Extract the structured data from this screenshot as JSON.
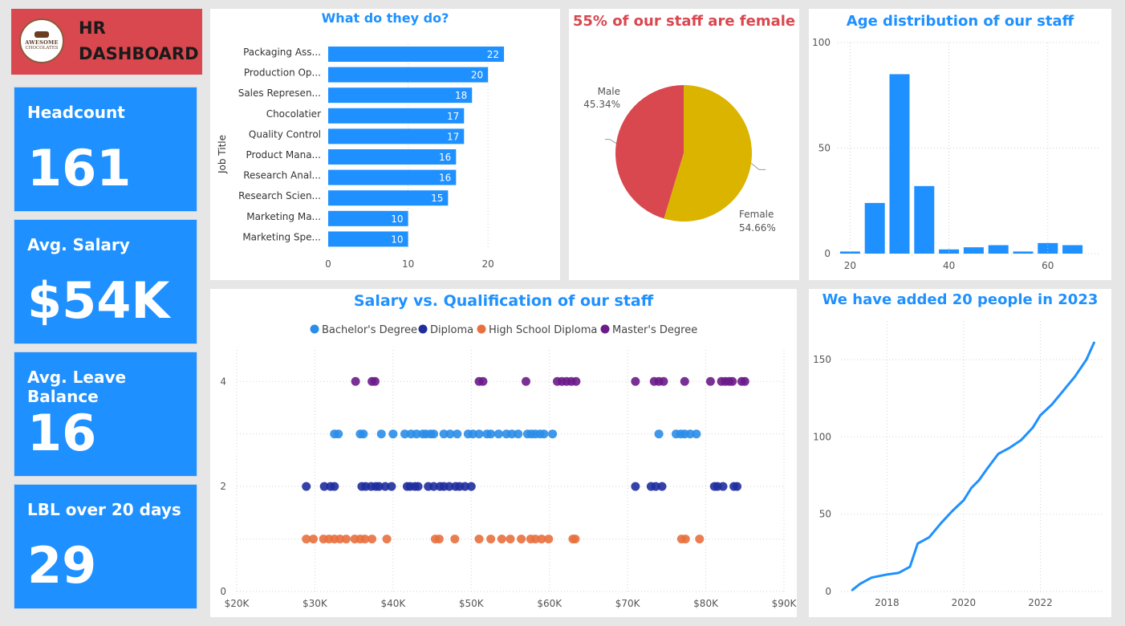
{
  "header": {
    "logo_line1": "AWESOME",
    "logo_line2": "CHOCOLATES",
    "title": "HR DASHBOARD"
  },
  "kpis": [
    {
      "label": "Headcount",
      "value": "161"
    },
    {
      "label": "Avg. Salary",
      "value": "$54K"
    },
    {
      "label": "Avg. Leave Balance",
      "value": "16"
    },
    {
      "label": "LBL over 20 days",
      "value": "29"
    }
  ],
  "colors": {
    "accent": "#1e90ff",
    "header": "#d9474f",
    "female": "#dbb400",
    "male": "#d9474f",
    "bachelor": "#2a8de8",
    "diploma": "#1f2d9e",
    "highschool": "#e8703e",
    "master": "#6b1b8a"
  },
  "jobs_chart": {
    "title": "What do they do?",
    "ylabel": "Job Title",
    "chart_data": {
      "type": "bar",
      "orientation": "horizontal",
      "categories": [
        "Packaging Ass...",
        "Production Op...",
        "Sales Represen...",
        "Chocolatier",
        "Quality Control",
        "Product Mana...",
        "Research Anal...",
        "Research Scien...",
        "Marketing Ma...",
        "Marketing Spe..."
      ],
      "values": [
        22,
        20,
        18,
        17,
        17,
        16,
        16,
        15,
        10,
        10
      ],
      "xticks": [
        "0",
        "10",
        "20"
      ],
      "xlim": [
        0,
        24
      ]
    }
  },
  "gender_chart": {
    "title": "55% of our staff are female",
    "chart_data": {
      "type": "pie",
      "labels": [
        "Male",
        "Female"
      ],
      "values": [
        45.34,
        54.66
      ],
      "pct_labels": [
        "45.34%",
        "54.66%"
      ]
    }
  },
  "age_chart": {
    "title": "Age distribution of our staff",
    "chart_data": {
      "type": "bar",
      "x": [
        20,
        25,
        30,
        35,
        40,
        45,
        50,
        55,
        60,
        65
      ],
      "values": [
        1,
        24,
        85,
        32,
        2,
        3,
        4,
        1,
        5,
        4
      ],
      "xticks": [
        "20",
        "40",
        "60"
      ],
      "yticks": [
        "0",
        "50",
        "100"
      ],
      "ylim": [
        0,
        100
      ]
    }
  },
  "scatter_chart": {
    "title": "Salary vs. Qualification of our staff",
    "legend": [
      "Bachelor's Degree",
      "Diploma",
      "High School Diploma",
      "Master's Degree"
    ],
    "chart_data": {
      "type": "scatter",
      "xticks": [
        "$20K",
        "$30K",
        "$40K",
        "$50K",
        "$60K",
        "$70K",
        "$80K",
        "$90K"
      ],
      "yticks": [
        "0",
        "2",
        "4"
      ],
      "xlim": [
        20000,
        90000
      ],
      "ylim": [
        0,
        4.6
      ],
      "series": [
        {
          "name": "Bachelor's Degree",
          "y": 3,
          "x": [
            32500,
            33000,
            35800,
            36200,
            38500,
            40000,
            41500,
            42300,
            43000,
            43800,
            44200,
            44800,
            45200,
            46500,
            47300,
            48200,
            49600,
            50200,
            51000,
            52000,
            52500,
            53500,
            54500,
            55200,
            56000,
            57200,
            57700,
            58200,
            58800,
            59300,
            60400,
            74000,
            76200,
            76800,
            77300,
            78000,
            78800
          ]
        },
        {
          "name": "Diploma",
          "y": 2,
          "x": [
            28900,
            31200,
            32000,
            32500,
            36000,
            36500,
            37200,
            37800,
            38200,
            39000,
            39800,
            41800,
            42200,
            42800,
            43200,
            44500,
            45200,
            46000,
            46500,
            47200,
            48000,
            48500,
            49200,
            50000,
            71000,
            73000,
            73600,
            74400,
            81100,
            81500,
            82200,
            83600,
            84000
          ]
        },
        {
          "name": "High School Diploma",
          "y": 1,
          "x": [
            28900,
            29800,
            31100,
            31800,
            32500,
            33200,
            34000,
            35100,
            35800,
            36400,
            37300,
            39200,
            45400,
            45900,
            47900,
            51000,
            52500,
            53900,
            55000,
            56400,
            57600,
            58200,
            59000,
            59900,
            63000,
            63300,
            76900,
            77400,
            79200
          ]
        },
        {
          "name": "Master's Degree",
          "y": 4,
          "x": [
            35200,
            37300,
            37700,
            51000,
            51500,
            57000,
            61000,
            61600,
            62200,
            62800,
            63400,
            71000,
            73400,
            74000,
            74600,
            77300,
            80600,
            82000,
            82500,
            83000,
            83400,
            84600,
            85000
          ]
        }
      ]
    }
  },
  "growth_chart": {
    "title": "We have added 20 people in 2023",
    "chart_data": {
      "type": "line",
      "x": [
        2017.1,
        2017.3,
        2017.6,
        2018.0,
        2018.3,
        2018.6,
        2018.8,
        2019.1,
        2019.4,
        2019.7,
        2020.0,
        2020.2,
        2020.4,
        2020.6,
        2020.9,
        2021.2,
        2021.5,
        2021.8,
        2022.0,
        2022.3,
        2022.6,
        2022.9,
        2023.2,
        2023.4
      ],
      "values": [
        1,
        5,
        9,
        11,
        12,
        16,
        31,
        35,
        44,
        52,
        59,
        67,
        72,
        79,
        89,
        93,
        98,
        106,
        114,
        121,
        130,
        139,
        150,
        161
      ],
      "xticks": [
        "2018",
        "2020",
        "2022"
      ],
      "xtick_values": [
        2018,
        2020,
        2022
      ],
      "yticks": [
        "0",
        "50",
        "100",
        "150"
      ],
      "xlim": [
        2016.8,
        2023.6
      ],
      "ylim": [
        0,
        175
      ]
    }
  }
}
